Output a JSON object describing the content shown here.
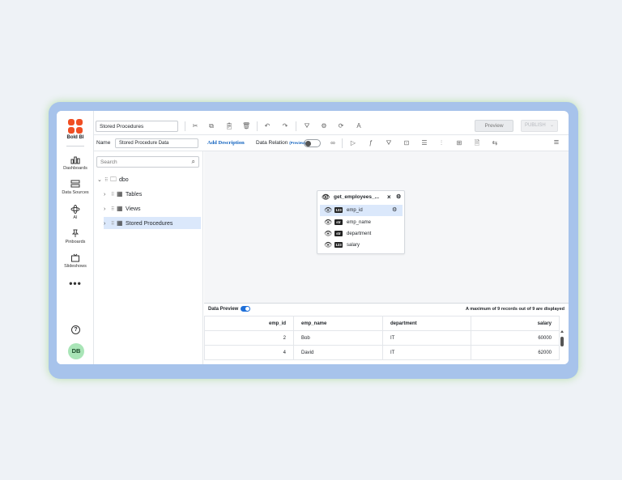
{
  "app": {
    "brand": "Bold BI",
    "nav": [
      {
        "label": "Dashboards",
        "icon": "dashboards-icon"
      },
      {
        "label": "Data Sources",
        "icon": "data-sources-icon"
      },
      {
        "label": "AI",
        "icon": "ai-icon"
      },
      {
        "label": "Pinboards",
        "icon": "pinboards-icon"
      },
      {
        "label": "Slideshows",
        "icon": "slideshows-icon"
      }
    ],
    "more": "•••",
    "help": "?",
    "user_initials": "DB"
  },
  "toolbar": {
    "title_value": "Stored Procedures",
    "preview_label": "Preview",
    "publish_label": "PUBLISH"
  },
  "toolbar2": {
    "name_label": "Name",
    "name_value": "Stored Procedure Data",
    "add_description": "Add Description",
    "data_relation": "Data Relation",
    "data_relation_tag": "(Preview)"
  },
  "tree": {
    "search_placeholder": "Search",
    "root": "dbo",
    "items": [
      {
        "label": "Tables"
      },
      {
        "label": "Views"
      },
      {
        "label": "Stored Procedures"
      }
    ]
  },
  "card": {
    "title": "get_employees_...",
    "fields": [
      {
        "type": "123",
        "name": "emp_id"
      },
      {
        "type": "str",
        "name": "emp_name"
      },
      {
        "type": "str",
        "name": "department"
      },
      {
        "type": "123",
        "name": "salary"
      }
    ]
  },
  "preview": {
    "label": "Data Preview",
    "message": "A maximum of 9 records out of 9 are displayed",
    "columns": [
      "emp_id",
      "emp_name",
      "department",
      "salary"
    ],
    "rows": [
      [
        "2",
        "Bob",
        "IT",
        "60000"
      ],
      [
        "4",
        "David",
        "IT",
        "62000"
      ]
    ]
  },
  "colors": {
    "accent": "#1e6fd9",
    "brand": "#f04e23",
    "selection": "#dbe8fb",
    "frame": "#a7c3eb"
  }
}
